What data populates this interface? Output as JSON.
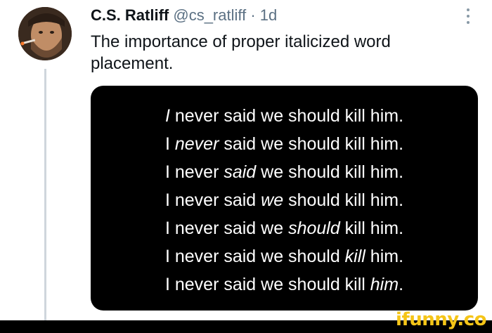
{
  "tweet": {
    "author_name": "C.S. Ratliff",
    "handle": "@cs_ratliff",
    "separator": "·",
    "time": "1d",
    "text": "The importance of proper italicized word placement."
  },
  "image_lines": [
    {
      "pre": "",
      "italic": "I",
      "post": " never said we should kill him."
    },
    {
      "pre": "I ",
      "italic": "never",
      "post": " said we should kill him."
    },
    {
      "pre": "I never ",
      "italic": "said",
      "post": " we should kill him."
    },
    {
      "pre": "I never said ",
      "italic": "we",
      "post": " should kill him."
    },
    {
      "pre": "I never said we ",
      "italic": "should",
      "post": " kill him."
    },
    {
      "pre": "I never said we should ",
      "italic": "kill",
      "post": " him."
    },
    {
      "pre": "I never said we should kill ",
      "italic": "him",
      "post": "."
    }
  ],
  "watermark": "ifunny.co"
}
